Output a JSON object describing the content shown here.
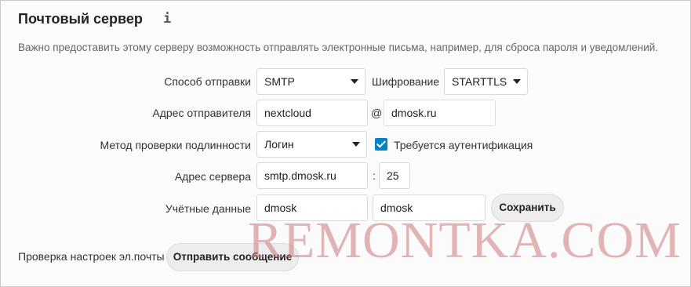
{
  "header": {
    "title": "Почтовый сервер",
    "info_icon": "i",
    "description": "Важно предоставить этому серверу возможность отправлять электронные письма, например, для сброса пароля и уведомлений."
  },
  "form": {
    "send_mode": {
      "label": "Способ отправки",
      "value": "SMTP"
    },
    "encryption": {
      "label": "Шифрование",
      "value": "STARTTLS"
    },
    "from_address": {
      "label": "Адрес отправителя",
      "user": "nextcloud",
      "at": "@",
      "domain": "dmosk.ru"
    },
    "auth_method": {
      "label": "Метод проверки подлинности",
      "value": "Логин"
    },
    "auth_required": {
      "label": "Требуется аутентификация",
      "checked": true
    },
    "server_address": {
      "label": "Адрес сервера",
      "host": "smtp.dmosk.ru",
      "colon": ":",
      "port": "25"
    },
    "credentials": {
      "label": "Учётные данные",
      "username": "dmosk",
      "password": "dmosk"
    },
    "save_label": "Сохранить"
  },
  "test": {
    "label": "Проверка настроек эл.почты",
    "send_label": "Отправить сообщение"
  },
  "watermark": "REMONTKA.COM",
  "colors": {
    "accent": "#0082c9",
    "watermark": "#cd7878"
  }
}
